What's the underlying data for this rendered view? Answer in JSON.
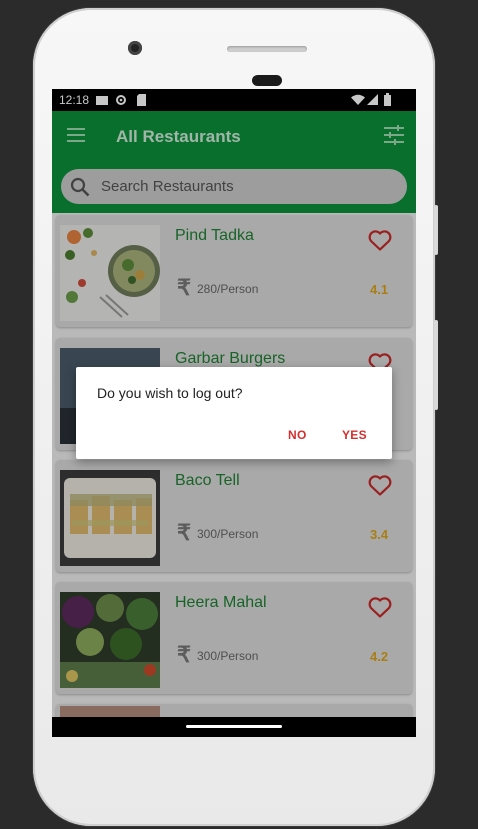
{
  "status_bar": {
    "time": "12:18"
  },
  "app_bar": {
    "title": "All Restaurants"
  },
  "search": {
    "placeholder": "Search Restaurants"
  },
  "restaurants": [
    {
      "name": "Pind Tadka",
      "price": "280/Person",
      "rating": "4.1"
    },
    {
      "name": "Garbar Burgers",
      "price": "",
      "rating": ""
    },
    {
      "name": "Baco Tell",
      "price": "300/Person",
      "rating": "3.4"
    },
    {
      "name": "Heera Mahal",
      "price": "300/Person",
      "rating": "4.2"
    }
  ],
  "currency_symbol": "₹",
  "dialog": {
    "message": "Do you wish to log out?",
    "no_label": "NO",
    "yes_label": "YES"
  },
  "colors": {
    "app_bar": "#0b8f3a",
    "name_text": "#1f7f33",
    "rating": "#d9a21a",
    "dialog_button": "#d32f2f"
  },
  "icons": [
    "menu-icon",
    "filter-icon",
    "search-icon",
    "heart-icon",
    "rupee-icon",
    "wifi-icon",
    "signal-icon",
    "battery-icon"
  ]
}
